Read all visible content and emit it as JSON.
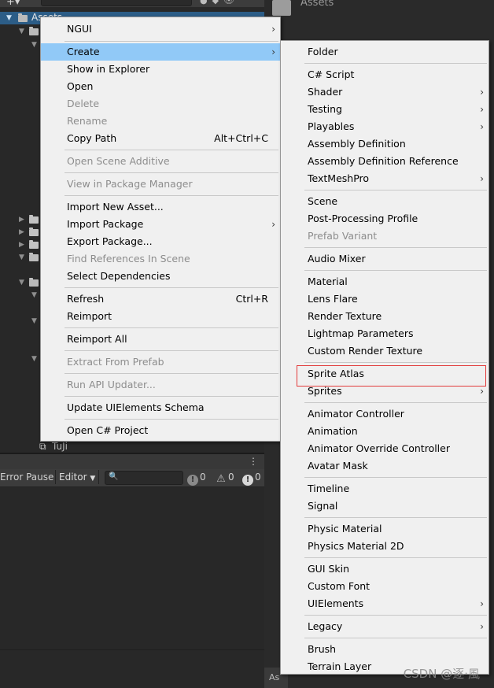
{
  "project": {
    "assets_label": "Assets",
    "tuji_label": "TuJi"
  },
  "right_pane": {
    "assets_label": "Assets",
    "bottom_label": "As"
  },
  "console": {
    "error_pause_label": "Error Pause",
    "editor_label": "Editor",
    "log_count": "0",
    "warning_count": "0",
    "error_count": "0"
  },
  "main_menu": {
    "items": [
      {
        "label": "NGUI",
        "submenu": true
      },
      {
        "label": "Create",
        "submenu": true,
        "highlighted": true
      },
      {
        "label": "Show in Explorer"
      },
      {
        "label": "Open"
      },
      {
        "label": "Delete",
        "disabled": true
      },
      {
        "label": "Rename",
        "disabled": true
      },
      {
        "label": "Copy Path",
        "shortcut": "Alt+Ctrl+C"
      },
      {
        "label": "Open Scene Additive",
        "disabled": true
      },
      {
        "label": "View in Package Manager",
        "disabled": true
      },
      {
        "label": "Import New Asset..."
      },
      {
        "label": "Import Package",
        "submenu": true
      },
      {
        "label": "Export Package..."
      },
      {
        "label": "Find References In Scene",
        "disabled": true
      },
      {
        "label": "Select Dependencies"
      },
      {
        "label": "Refresh",
        "shortcut": "Ctrl+R"
      },
      {
        "label": "Reimport"
      },
      {
        "label": "Reimport All"
      },
      {
        "label": "Extract From Prefab",
        "disabled": true
      },
      {
        "label": "Run API Updater...",
        "disabled": true
      },
      {
        "label": "Update UIElements Schema"
      },
      {
        "label": "Open C# Project"
      }
    ]
  },
  "create_menu": {
    "items": [
      {
        "label": "Folder"
      },
      {
        "label": "C# Script"
      },
      {
        "label": "Shader",
        "submenu": true
      },
      {
        "label": "Testing",
        "submenu": true
      },
      {
        "label": "Playables",
        "submenu": true
      },
      {
        "label": "Assembly Definition"
      },
      {
        "label": "Assembly Definition Reference"
      },
      {
        "label": "TextMeshPro",
        "submenu": true
      },
      {
        "label": "Scene"
      },
      {
        "label": "Post-Processing Profile"
      },
      {
        "label": "Prefab Variant",
        "disabled": true
      },
      {
        "label": "Audio Mixer"
      },
      {
        "label": "Material"
      },
      {
        "label": "Lens Flare"
      },
      {
        "label": "Render Texture"
      },
      {
        "label": "Lightmap Parameters"
      },
      {
        "label": "Custom Render Texture"
      },
      {
        "label": "Sprite Atlas",
        "annotated": true
      },
      {
        "label": "Sprites",
        "submenu": true
      },
      {
        "label": "Animator Controller"
      },
      {
        "label": "Animation"
      },
      {
        "label": "Animator Override Controller"
      },
      {
        "label": "Avatar Mask"
      },
      {
        "label": "Timeline"
      },
      {
        "label": "Signal"
      },
      {
        "label": "Physic Material"
      },
      {
        "label": "Physics Material 2D"
      },
      {
        "label": "GUI Skin"
      },
      {
        "label": "Custom Font"
      },
      {
        "label": "UIElements",
        "submenu": true
      },
      {
        "label": "Legacy",
        "submenu": true
      },
      {
        "label": "Brush"
      },
      {
        "label": "Terrain Layer"
      }
    ]
  },
  "watermark": "CSDN @逐·風"
}
